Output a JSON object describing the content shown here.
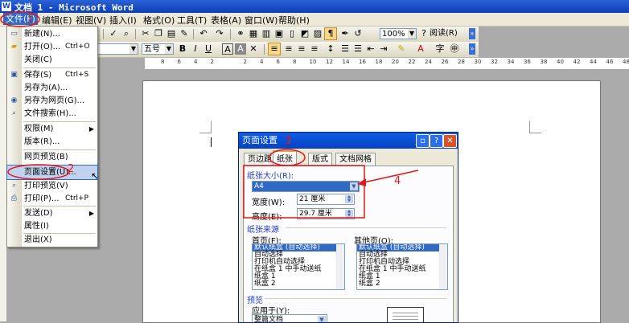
{
  "window": {
    "title": "文档 1 - Microsoft Word",
    "icon": "W"
  },
  "menubar": {
    "items": [
      "文件(F)",
      "编辑(E)",
      "视图(V)",
      "插入(I)",
      "格式(O)",
      "工具(T)",
      "表格(A)",
      "窗口(W)",
      "帮助(H)"
    ]
  },
  "toolbar": {
    "zoom": "100%",
    "read": "阅读(R)",
    "fontsize": "五号"
  },
  "ruler": {
    "ticks": [
      "8",
      "6",
      "4",
      "2",
      "",
      "2",
      "4",
      "6",
      "8",
      "10",
      "12",
      "14",
      "16",
      "18",
      "20",
      "22",
      "24",
      "26",
      "28",
      "30",
      "32",
      "34",
      "36",
      "38",
      "40",
      "42",
      "44",
      "46",
      "48"
    ]
  },
  "filemenu": {
    "items": [
      {
        "label": "新建(N)...",
        "shortcut": ""
      },
      {
        "label": "打开(O)...",
        "shortcut": "Ctrl+O"
      },
      {
        "label": "关闭(C)",
        "shortcut": ""
      },
      {
        "label": "保存(S)",
        "shortcut": "Ctrl+S"
      },
      {
        "label": "另存为(A)...",
        "shortcut": ""
      },
      {
        "label": "另存为网页(G)...",
        "shortcut": ""
      },
      {
        "label": "文件搜索(H)...",
        "shortcut": ""
      },
      {
        "label": "权限(M)",
        "shortcut": ""
      },
      {
        "label": "版本(R)...",
        "shortcut": ""
      },
      {
        "label": "网页预览(B)",
        "shortcut": ""
      },
      {
        "label": "页面设置(U)...",
        "shortcut": ""
      },
      {
        "label": "打印预览(V)",
        "shortcut": ""
      },
      {
        "label": "打印(P)...",
        "shortcut": "Ctrl+P"
      },
      {
        "label": "发送(D)",
        "shortcut": ""
      },
      {
        "label": "属性(I)",
        "shortcut": ""
      },
      {
        "label": "退出(X)",
        "shortcut": ""
      }
    ]
  },
  "dialog": {
    "title": "页面设置",
    "tabs": [
      "页边距",
      "纸张",
      "版式",
      "文档网格"
    ],
    "paper_size_label": "纸张大小(R):",
    "paper_size_value": "A4",
    "width_label": "宽度(W):",
    "width_value": "21 厘米",
    "height_label": "高度(E):",
    "height_value": "29.7 厘米",
    "paper_source_label": "纸张来源",
    "first_page_label": "首页(F):",
    "other_pages_label": "其他页(O):",
    "trays": [
      "默认纸盒 (自动选择)",
      "自动选择",
      "打印机自动选择",
      "在纸盒 1 中手动送纸",
      "纸盒 1",
      "纸盒 2"
    ],
    "preview_label": "预览",
    "apply_to_label": "应用于(Y):",
    "apply_to_value": "整篇文档"
  },
  "annotations": {
    "n1": "1",
    "n2": "2",
    "n3": "3",
    "n4": "4"
  },
  "colors": {
    "accent": "#316ac5",
    "annotation": "#e01a1a"
  }
}
